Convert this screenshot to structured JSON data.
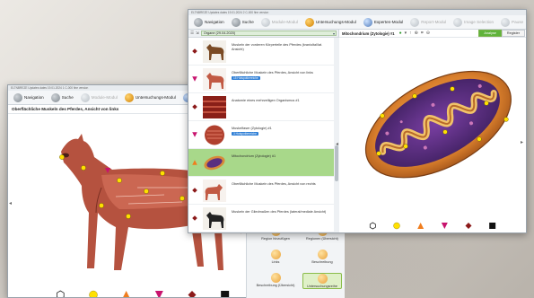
{
  "win1": {
    "titlebar": "ELTNBREZE  Updates dates 19.01.2024 1 C-000  fine version",
    "toolbar": [
      {
        "label": "Navigation",
        "icon": "arrow-left-icon",
        "style": "grey"
      },
      {
        "label": "Suche",
        "icon": "search-icon",
        "style": "grey"
      },
      {
        "label": "Module-Modul",
        "icon": "module-icon",
        "style": "pale"
      },
      {
        "label": "Untersuchungs-Modul",
        "icon": "exam-icon",
        "style": "orange"
      },
      {
        "label": "Ex",
        "icon": "expert-icon",
        "style": "blue"
      }
    ],
    "heading": "Oberflächliche Muskeln des Pferdes, Ansicht von links"
  },
  "win2": {
    "titlebar": "ELTNBREZE  Updates dates 19.01.2024 2 C-000  fine version",
    "toolbar": [
      {
        "label": "Navigation",
        "icon": "arrow-left-icon",
        "style": "grey"
      },
      {
        "label": "Suche",
        "icon": "search-icon",
        "style": "grey"
      },
      {
        "label": "Module-Modul",
        "icon": "module-icon",
        "style": "pale"
      },
      {
        "label": "Untersuchungs-Modul",
        "icon": "exam-icon",
        "style": "orange"
      },
      {
        "label": "Experten-Modul",
        "icon": "expert-icon",
        "style": "blue"
      },
      {
        "label": "Report-Modul",
        "icon": "report-icon",
        "style": "pale"
      },
      {
        "label": "Image Selection",
        "icon": "image-icon",
        "style": "pale"
      },
      {
        "label": "Pause",
        "icon": "pause-icon",
        "style": "pale"
      }
    ],
    "list_dropdown": "Organe (29.04.2020)",
    "rows": [
      {
        "text": "Muskeln der vorderen Körperteile des Pferdes (kranioltal/lat. Ansicht)",
        "badge": "",
        "marker": "diamond",
        "thumb": "horse-brown",
        "selected": false
      },
      {
        "text": "Oberflächliche Muskeln des Pferdes, Ansicht von links",
        "badge": "15 Hotspotbereiche",
        "marker": "triangle-down",
        "thumb": "horse-muscle",
        "selected": false
      },
      {
        "text": "Anatomie eines mehrzelligen Organismus #1",
        "badge": "",
        "marker": "diamond",
        "thumb": "tissue-red",
        "selected": false
      },
      {
        "text": "Muskelfaser (Zytologie) #1",
        "badge": "3 Hotspotbereiche",
        "marker": "triangle-down",
        "thumb": "muscle-fiber",
        "selected": false
      },
      {
        "text": "Mitochondrium (Zytologie) #1",
        "badge": "",
        "marker": "triangle-up",
        "thumb": "mito",
        "selected": true
      },
      {
        "text": "Oberflächliche Muskeln des Pferdes, Ansicht von rechts",
        "badge": "",
        "marker": "diamond",
        "thumb": "horse-muscle-r",
        "selected": false
      },
      {
        "text": "Muskeln der Gliedmaßen des Pferdes (lateral/mediale Ansicht)",
        "badge": "",
        "marker": "diamond",
        "thumb": "horse-black",
        "selected": false
      }
    ],
    "detail_title": "Mitochondrium (Zytologie) #1",
    "view_tabs": {
      "analyse": "Analyse",
      "register": "Register"
    }
  },
  "side_panel": [
    {
      "label": "Region hinzufügen",
      "icon": "add-region-icon"
    },
    {
      "label": "Regionen (Übersicht)",
      "icon": "regions-icon"
    },
    {
      "label": "Links",
      "icon": "link-icon"
    },
    {
      "label": "Beschreibung",
      "icon": "description-icon"
    },
    {
      "label": "Beschreibung (Übersicht)",
      "icon": "description-overview-icon"
    },
    {
      "label": "Untersuchungsreihe",
      "icon": "exam-series-icon"
    }
  ],
  "marker_shapes": [
    "hexagon",
    "circle",
    "triangle-up",
    "triangle-down",
    "diamond",
    "square"
  ],
  "colors": {
    "accent_green": "#5fb33a",
    "selection": "#a8d88a",
    "yellow": "#ffe000",
    "orange": "#f07d1e",
    "magenta": "#c8146e",
    "darkred": "#8c1a1a",
    "black": "#111111"
  }
}
